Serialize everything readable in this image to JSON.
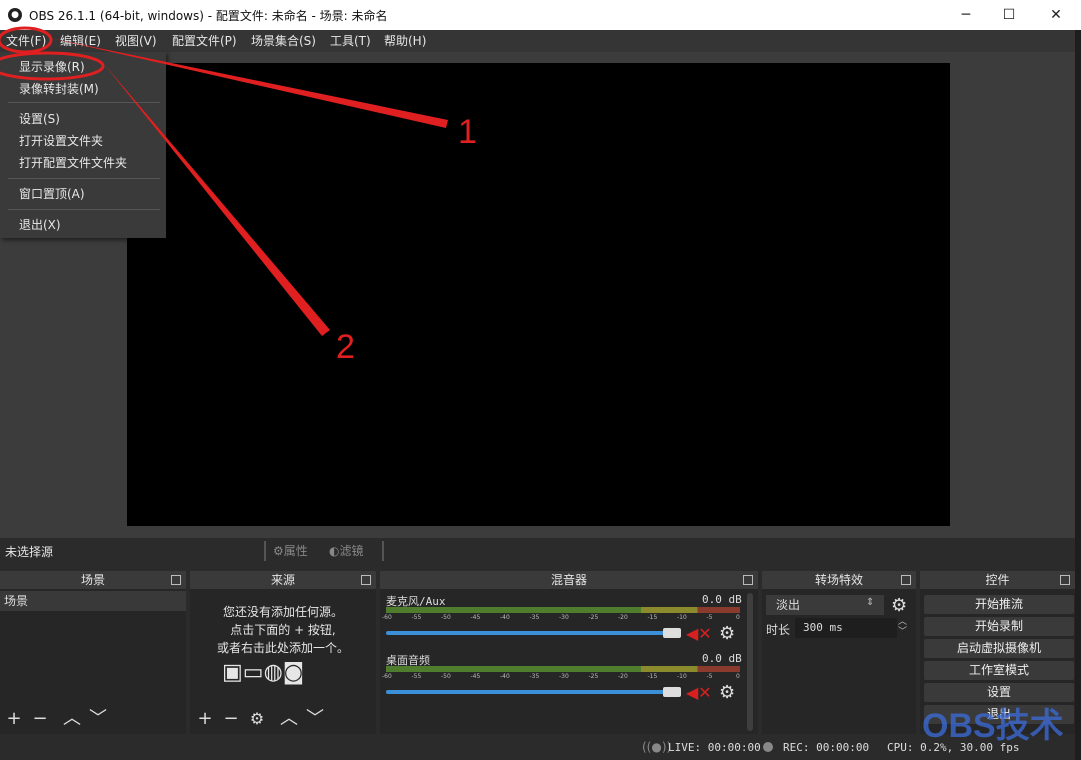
{
  "window": {
    "title": "OBS 26.1.1 (64-bit, windows) - 配置文件: 未命名 - 场景: 未命名",
    "minimize": "─",
    "maximize": "☐",
    "close": "✕"
  },
  "menubar": [
    {
      "label": "文件(F)"
    },
    {
      "label": "编辑(E)"
    },
    {
      "label": "视图(V)"
    },
    {
      "label": "配置文件(P)"
    },
    {
      "label": "场景集合(S)"
    },
    {
      "label": "工具(T)"
    },
    {
      "label": "帮助(H)"
    }
  ],
  "file_menu": [
    {
      "label": "显示录像(R)"
    },
    {
      "label": "录像转封装(M)"
    },
    {
      "label": "设置(S)"
    },
    {
      "label": "打开设置文件夹"
    },
    {
      "label": "打开配置文件文件夹"
    },
    {
      "label": "窗口置顶(A)"
    },
    {
      "label": "退出(X)"
    }
  ],
  "annotations": {
    "one": "1",
    "two": "2",
    "color": "#e02020"
  },
  "source_toolbar": {
    "no_source": "未选择源",
    "properties": "属性",
    "filters": "滤镜"
  },
  "docks": {
    "scenes": {
      "title": "场景",
      "items": [
        "场景"
      ]
    },
    "sources": {
      "title": "来源",
      "empty_line1": "您还没有添加任何源。",
      "empty_line2": "点击下面的 + 按钮,",
      "empty_line3": "或者右击此处添加一个。"
    },
    "mixer": {
      "title": "混音器",
      "tracks": [
        {
          "name": "麦克风/Aux",
          "level": "0.0 dB",
          "volume_fraction": 0.96
        },
        {
          "name": "桌面音频",
          "level": "0.0 dB",
          "volume_fraction": 0.96
        }
      ],
      "ticks": [
        "-60",
        "-55",
        "-50",
        "-45",
        "-40",
        "-35",
        "-30",
        "-25",
        "-20",
        "-15",
        "-10",
        "-5",
        "0"
      ]
    },
    "transitions": {
      "title": "转场特效",
      "selected": "淡出",
      "duration_label": "时长",
      "duration_value": "300 ms"
    },
    "controls": {
      "title": "控件",
      "buttons": [
        "开始推流",
        "开始录制",
        "启动虚拟摄像机",
        "工作室模式",
        "设置",
        "退出"
      ]
    }
  },
  "status": {
    "live": "LIVE: 00:00:00",
    "rec": "REC: 00:00:00",
    "cpu": "CPU: 0.2%, 30.00 fps"
  },
  "watermark": "OBS技术",
  "colors": {
    "accent": "#3a8fd8",
    "mute": "#d82020"
  }
}
